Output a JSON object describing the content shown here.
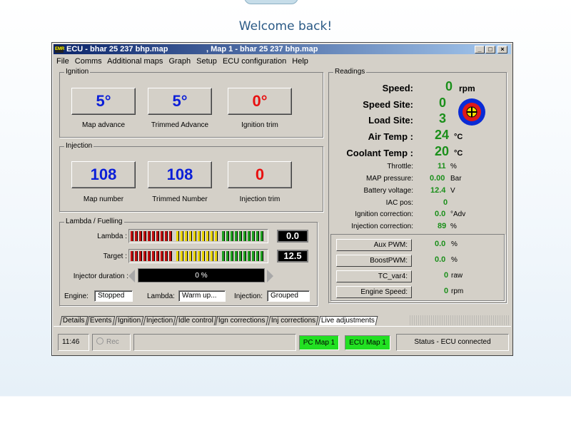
{
  "header": {
    "welcome": "Welcome back!"
  },
  "window": {
    "title_left": "ECU - bhar 25 237 bhp.map",
    "title_right": ", Map 1 - bhar 25 237 bhp.map",
    "icon_text": "EMR",
    "menu": [
      "File",
      "Comms",
      "Additional maps",
      "Graph",
      "Setup",
      "ECU configuration",
      "Help"
    ]
  },
  "ignition": {
    "label": "Ignition",
    "map_advance": "5°",
    "map_advance_label": "Map advance",
    "trimmed_advance": "5°",
    "trimmed_advance_label": "Trimmed Advance",
    "ignition_trim": "0°",
    "ignition_trim_label": "Ignition trim"
  },
  "injection": {
    "label": "Injection",
    "map_number": "108",
    "map_number_label": "Map number",
    "trimmed_number": "108",
    "trimmed_number_label": "Trimmed Number",
    "injection_trim": "0",
    "injection_trim_label": "Injection trim"
  },
  "lambda": {
    "label": "Lambda / Fuelling",
    "lambda_label": "Lambda :",
    "lambda_value": "0.0",
    "target_label": "Target :",
    "target_value": "12.5",
    "injector_duration_label": "Injector duration :",
    "injector_duration_value": "0 %",
    "engine_label": "Engine:",
    "engine_value": "Stopped",
    "lambda_status_label": "Lambda:",
    "lambda_status_value": "Warm up...",
    "injection_label": "Injection:",
    "injection_value": "Grouped"
  },
  "readings": {
    "label": "Readings",
    "speed_label": "Speed:",
    "speed_value": "0",
    "speed_unit": "rpm",
    "speed_site_label": "Speed Site:",
    "speed_site_value": "0",
    "load_site_label": "Load Site:",
    "load_site_value": "3",
    "air_temp_label": "Air Temp :",
    "air_temp_value": "24",
    "air_temp_unit": "°C",
    "coolant_temp_label": "Coolant Temp :",
    "coolant_temp_value": "20",
    "coolant_temp_unit": "°C",
    "throttle_label": "Throttle:",
    "throttle_value": "11",
    "throttle_unit": "%",
    "map_pressure_label": "MAP pressure:",
    "map_pressure_value": "0.00",
    "map_pressure_unit": "Bar",
    "battery_label": "Battery voltage:",
    "battery_value": "12.4",
    "battery_unit": "V",
    "iac_label": "IAC pos:",
    "iac_value": "0",
    "ign_corr_label": "Ignition correction:",
    "ign_corr_value": "0.0",
    "ign_corr_unit": "°Adv",
    "inj_corr_label": "Injection correction:",
    "inj_corr_value": "89",
    "inj_corr_unit": "%"
  },
  "aux": [
    {
      "label": "Aux PWM:",
      "value": "0.0",
      "unit": "%"
    },
    {
      "label": "BoostPWM:",
      "value": "0.0",
      "unit": "%"
    },
    {
      "label": "TC_var4:",
      "value": "0",
      "unit": "raw"
    },
    {
      "label": "Engine Speed:",
      "value": "0",
      "unit": "rpm"
    }
  ],
  "tabs": [
    "Details",
    "Events",
    "Ignition",
    "Injection",
    "Idle control",
    "Ign corrections",
    "Inj corrections",
    "Live adjustments"
  ],
  "status": {
    "time": "11:46",
    "rec": "Rec",
    "pc_map": "PC Map 1",
    "ecu_map": "ECU Map 1",
    "connection": "Status - ECU connected",
    "map_indicator_color": "#00ff00"
  },
  "colors": {
    "value_blue": "#0b1fd8",
    "value_red": "#e81010",
    "value_green": "#1a8f1a",
    "title_bar": "#0a246a"
  }
}
